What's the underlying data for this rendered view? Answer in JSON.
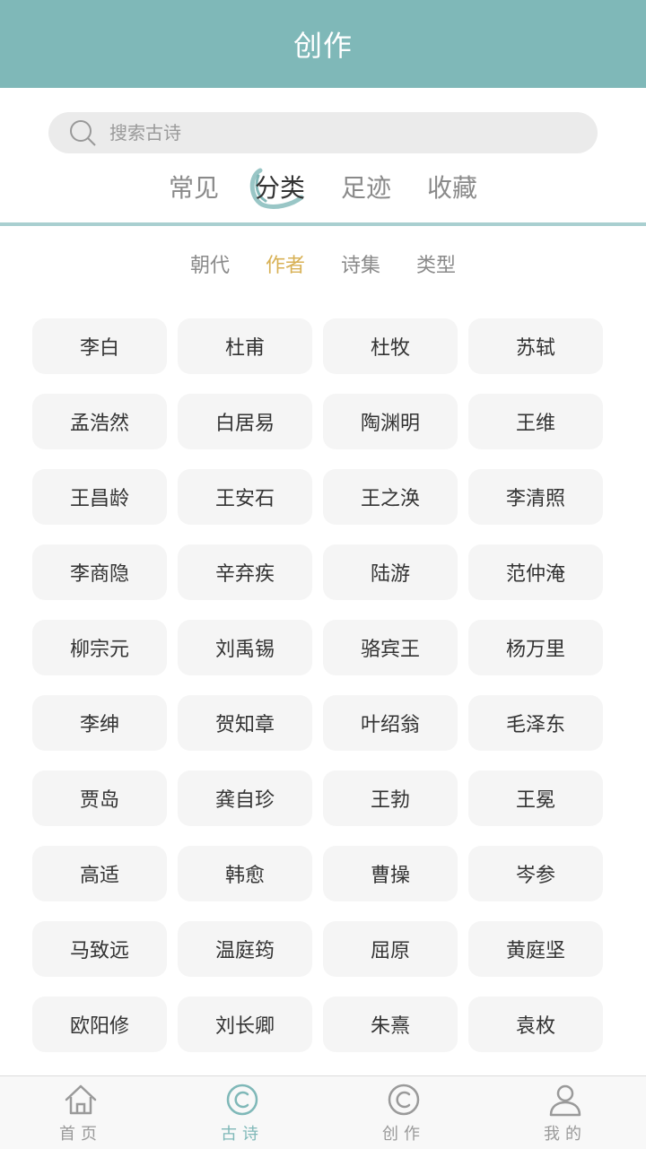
{
  "header": {
    "title": "创作"
  },
  "search": {
    "placeholder": "搜索古诗"
  },
  "main_tabs": [
    {
      "label": "常见"
    },
    {
      "label": "分类"
    },
    {
      "label": "足迹"
    },
    {
      "label": "收藏"
    }
  ],
  "sub_tabs": [
    {
      "label": "朝代"
    },
    {
      "label": "作者"
    },
    {
      "label": "诗集"
    },
    {
      "label": "类型"
    }
  ],
  "poets": [
    "李白",
    "杜甫",
    "杜牧",
    "苏轼",
    "孟浩然",
    "白居易",
    "陶渊明",
    "王维",
    "王昌龄",
    "王安石",
    "王之涣",
    "李清照",
    "李商隐",
    "辛弃疾",
    "陆游",
    "范仲淹",
    "柳宗元",
    "刘禹锡",
    "骆宾王",
    "杨万里",
    "李绅",
    "贺知章",
    "叶绍翁",
    "毛泽东",
    "贾岛",
    "龚自珍",
    "王勃",
    "王冕",
    "高适",
    "韩愈",
    "曹操",
    "岑参",
    "马致远",
    "温庭筠",
    "屈原",
    "黄庭坚",
    "欧阳修",
    "刘长卿",
    "朱熹",
    "袁枚"
  ],
  "bottom_nav": [
    {
      "label": "首页",
      "icon": "home-icon"
    },
    {
      "label": "古诗",
      "icon": "copyright-circle-icon"
    },
    {
      "label": "创作",
      "icon": "copyright-circle-icon"
    },
    {
      "label": "我的",
      "icon": "user-icon"
    }
  ],
  "colors": {
    "header_bg": "#7fb8b8",
    "active_sub_tab": "#d8b155",
    "active_nav": "#7fb8b8"
  }
}
